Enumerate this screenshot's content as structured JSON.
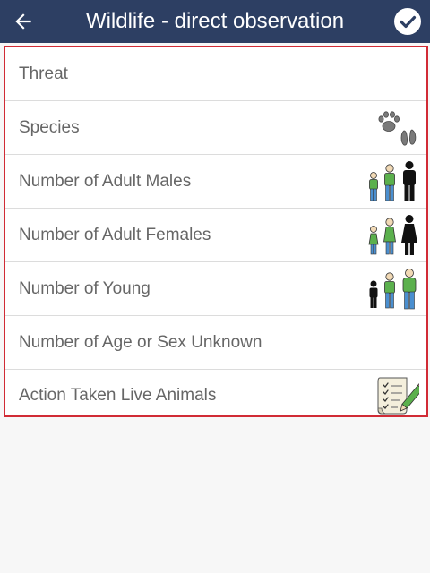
{
  "appbar": {
    "title": "Wildlife - direct observation",
    "back_icon": "arrow-left-icon",
    "confirm_icon": "check-circle-icon",
    "color": "#2d3f63"
  },
  "list": {
    "border_color": "#d12b35",
    "items": [
      {
        "label": "Threat",
        "icon": ""
      },
      {
        "label": "Species",
        "icon": "paw-hoof-tracks-icon"
      },
      {
        "label": "Number of Adult Males",
        "icon": "male-group-icon"
      },
      {
        "label": "Number of Adult Females",
        "icon": "female-group-icon"
      },
      {
        "label": "Number of Young",
        "icon": "young-group-icon"
      },
      {
        "label": "Number of Age or Sex Unknown",
        "icon": ""
      },
      {
        "label": "Action Taken Live Animals",
        "icon": "checklist-pencil-icon"
      }
    ]
  }
}
